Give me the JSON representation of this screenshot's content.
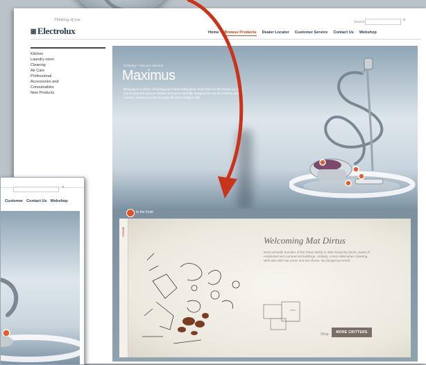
{
  "header": {
    "tagline": "Thinking of you",
    "logo_mark": "⧆",
    "logo": "Electrolux",
    "search_label": "Search",
    "search_value": "",
    "search_go": "»"
  },
  "nav": {
    "items": [
      "Home",
      "Browse Products",
      "Dealer Locator",
      "Customer Service",
      "Contact Us",
      "Webshop"
    ],
    "active_index": 1
  },
  "sidebar": {
    "items": [
      "Kitchen",
      "Laundry room",
      "Cleaning",
      "Air Care",
      "Professional",
      "Accessories and",
      "Consumables",
      "New Products"
    ]
  },
  "hero": {
    "breadcrumb": "Cleaning > Vacuum cleaners",
    "title": "Maximus",
    "description": "Bring joy to a chore. Cleaning your home today gives more time for the things you love. Our household vacuum cleaner has been carefully designed to suit all surfaces and all corners, leaving you free to enjoy the nicer things in life."
  },
  "tour": {
    "label": "In the Field"
  },
  "card": {
    "tab_label": "Details",
    "title": "Welcoming Mat Dirtus",
    "description": "Most versatile member of the Dirtus family is often found by doors, sweet of residential and commercial buildings. Unlikely, cross-rolled when cleaning. Well also with hair press and wet shoes. No dangerous smell.",
    "small_text": "Shop",
    "button_label": "MORE CRITTERS"
  },
  "zoom": {
    "nav_items": [
      "Customer",
      "Contact Us",
      "Webshop"
    ],
    "search_go": "»"
  },
  "colors": {
    "accent": "#d04a1a",
    "arrow": "#c8331a",
    "button": "#7a6f66"
  }
}
